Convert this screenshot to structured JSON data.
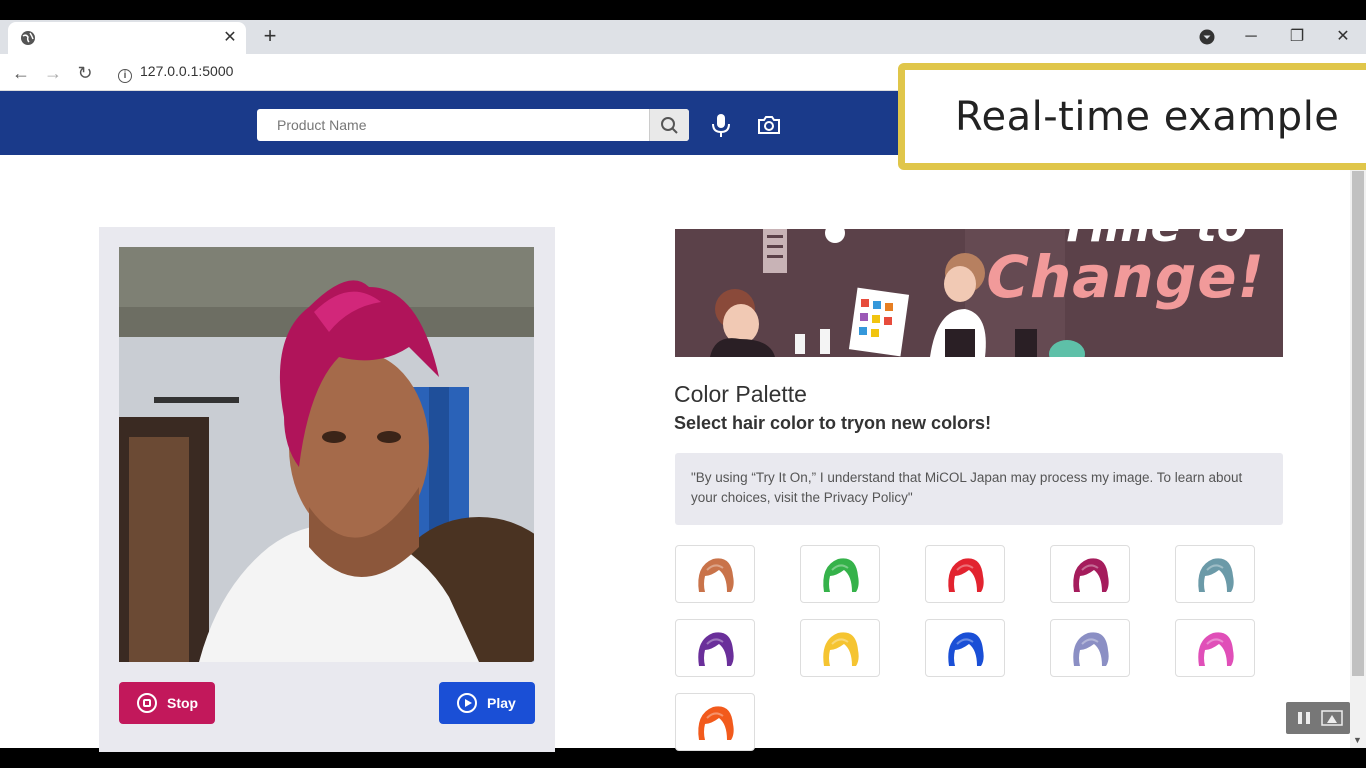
{
  "browser": {
    "tab_title": "",
    "url": "127.0.0.1:5000",
    "new_tab": "+"
  },
  "header": {
    "search_placeholder": "Product Name"
  },
  "webcam": {
    "stop_label": "Stop",
    "play_label": "Play"
  },
  "banner": {
    "text_top": "Time to",
    "text_main": "Change!"
  },
  "palette": {
    "title": "Color Palette",
    "subtitle": "Select hair color to tryon new colors!",
    "notice": "\"By using “Try It On,” I understand that MiCOL Japan may process my image. To learn about your choices, visit the Privacy Policy\"",
    "swatches": [
      {
        "name": "copper",
        "color": "#c9734a"
      },
      {
        "name": "green",
        "color": "#35b24a"
      },
      {
        "name": "red",
        "color": "#e2232f"
      },
      {
        "name": "magenta",
        "color": "#a51c5c"
      },
      {
        "name": "teal-grey",
        "color": "#6b9aa8"
      },
      {
        "name": "purple",
        "color": "#6a2f9a"
      },
      {
        "name": "yellow",
        "color": "#f5c431"
      },
      {
        "name": "blue",
        "color": "#1a4fd6"
      },
      {
        "name": "lavender",
        "color": "#8b8fc4"
      },
      {
        "name": "pink",
        "color": "#e04fb8"
      },
      {
        "name": "orange",
        "color": "#f25a1c"
      }
    ]
  },
  "overlay": {
    "text": "Real-time example"
  },
  "colors": {
    "header_bg": "#1a3a8a",
    "stop_btn": "#c2185b",
    "play_btn": "#1a4fd6",
    "overlay_border": "#e0c64a"
  }
}
